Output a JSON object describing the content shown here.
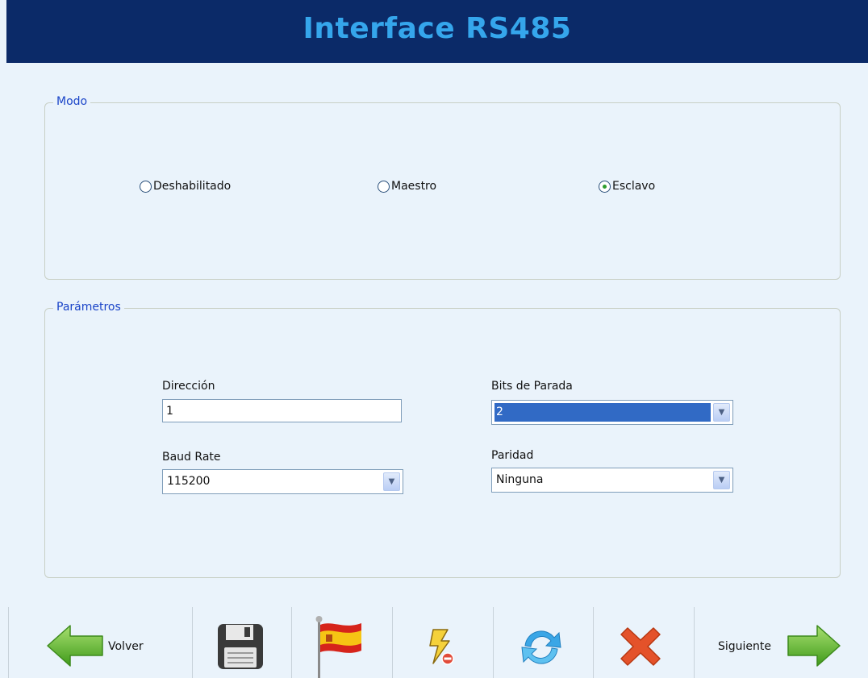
{
  "header": {
    "title": "Interface RS485"
  },
  "modo": {
    "legend": "Modo",
    "options": [
      {
        "label": "Deshabilitado",
        "selected": false
      },
      {
        "label": "Maestro",
        "selected": false
      },
      {
        "label": "Esclavo",
        "selected": true
      }
    ]
  },
  "parametros": {
    "legend": "Parámetros",
    "direccion": {
      "label": "Dirección",
      "value": "1"
    },
    "baud_rate": {
      "label": "Baud Rate",
      "value": "115200"
    },
    "bits_parada": {
      "label": "Bits de Parada",
      "value": "2"
    },
    "paridad": {
      "label": "Paridad",
      "value": "Ninguna"
    }
  },
  "toolbar": {
    "back_label": "Volver",
    "next_label": "Siguiente",
    "icons": [
      "arrow-left-icon",
      "floppy-disk-icon",
      "spain-flag-icon",
      "lightning-no-power-icon",
      "refresh-icon",
      "close-x-icon",
      "arrow-right-icon"
    ]
  },
  "colors": {
    "header_bg": "#0b2a68",
    "title": "#35a6ec",
    "legend": "#1a44c8",
    "panel_bg": "#eaf3fb",
    "selection": "#316ac5"
  }
}
